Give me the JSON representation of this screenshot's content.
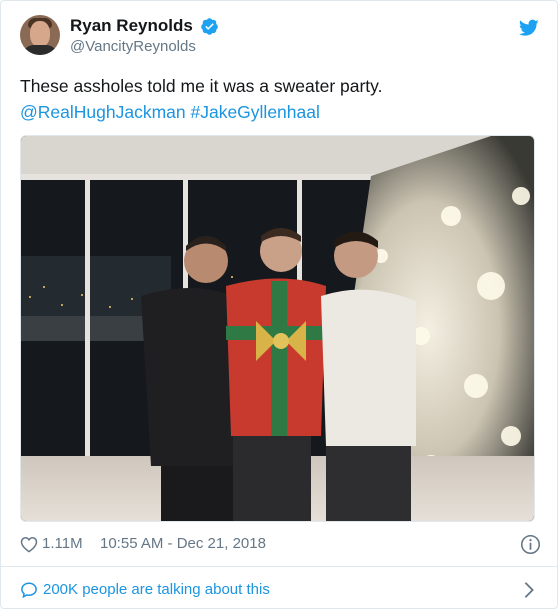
{
  "author": {
    "display_name": "Ryan Reynolds",
    "handle": "@VancityReynolds",
    "verified": true
  },
  "tweet": {
    "text": "These assholes told me it was a sweater party.",
    "mentions": "@RealHughJackman #JakeGyllenhaal"
  },
  "stats": {
    "likes": "1.11M",
    "timestamp": "10:55 AM - Dec 21, 2018"
  },
  "footer": {
    "talking_text": "200K people are talking about this"
  },
  "icons": {
    "verified": "verified-badge-icon",
    "brand": "twitter-bird-icon",
    "like": "heart-icon",
    "info": "info-icon",
    "reply": "speech-bubble-icon",
    "chevron": "chevron-right-icon"
  },
  "colors": {
    "accent": "#1b95e0",
    "brand": "#1da1f2",
    "muted": "#657786",
    "text": "#14171a",
    "border": "#e1e8ed"
  }
}
